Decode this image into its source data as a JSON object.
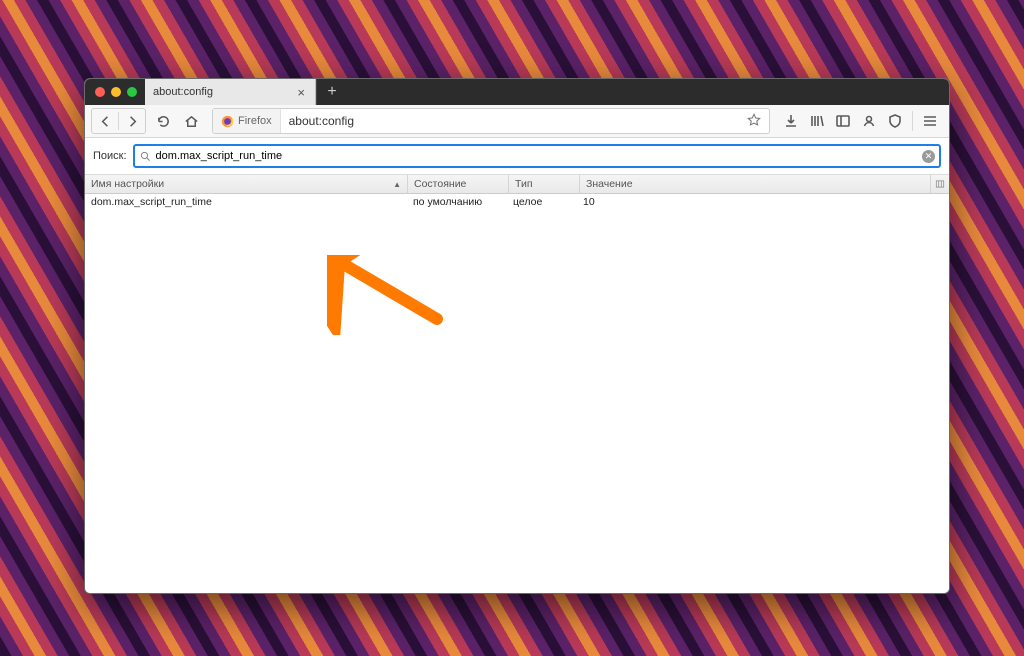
{
  "tabbar": {
    "active_tab_title": "about:config"
  },
  "toolbar": {
    "brand_label": "Firefox",
    "url_text": "about:config"
  },
  "search": {
    "label": "Поиск:",
    "value": "dom.max_script_run_time"
  },
  "columns": {
    "name": "Имя настройки",
    "state": "Состояние",
    "type": "Тип",
    "value": "Значение"
  },
  "rows": [
    {
      "name": "dom.max_script_run_time",
      "state": "по умолчанию",
      "type": "целое",
      "value": "10"
    }
  ]
}
